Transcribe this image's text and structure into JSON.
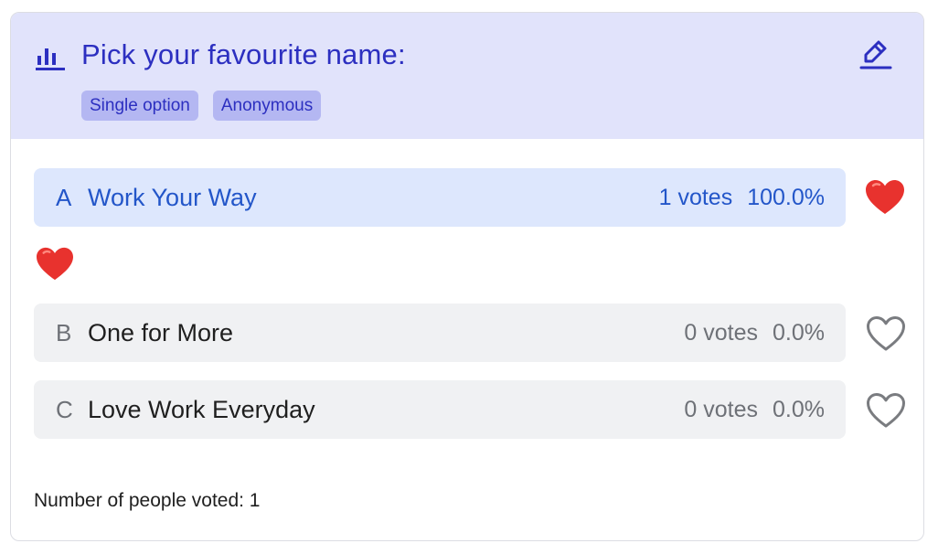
{
  "poll": {
    "title": "Pick your favourite name:",
    "tags": [
      "Single option",
      "Anonymous"
    ],
    "options": [
      {
        "letter": "A",
        "label": "Work Your Way",
        "votes": "1 votes",
        "percent": "100.0%",
        "selected": true
      },
      {
        "letter": "B",
        "label": "One for More",
        "votes": "0 votes",
        "percent": "0.0%",
        "selected": false
      },
      {
        "letter": "C",
        "label": "Love Work Everyday",
        "votes": "0 votes",
        "percent": "0.0%",
        "selected": false
      }
    ],
    "footer_text": "Number of people voted: 1"
  },
  "icons": {
    "poll": "bar-chart-icon",
    "edit": "pencil-icon",
    "voted": "heart-filled-icon",
    "not_voted": "heart-outline-icon"
  },
  "colors": {
    "accent": "#2c2fc0",
    "header_bg": "#e1e3fb",
    "tag_bg": "#b4b7f2",
    "selected_bg": "#dde7fd",
    "selected_text": "#2356c9",
    "option_bg": "#f0f1f3",
    "heart_red": "#e8322e"
  }
}
